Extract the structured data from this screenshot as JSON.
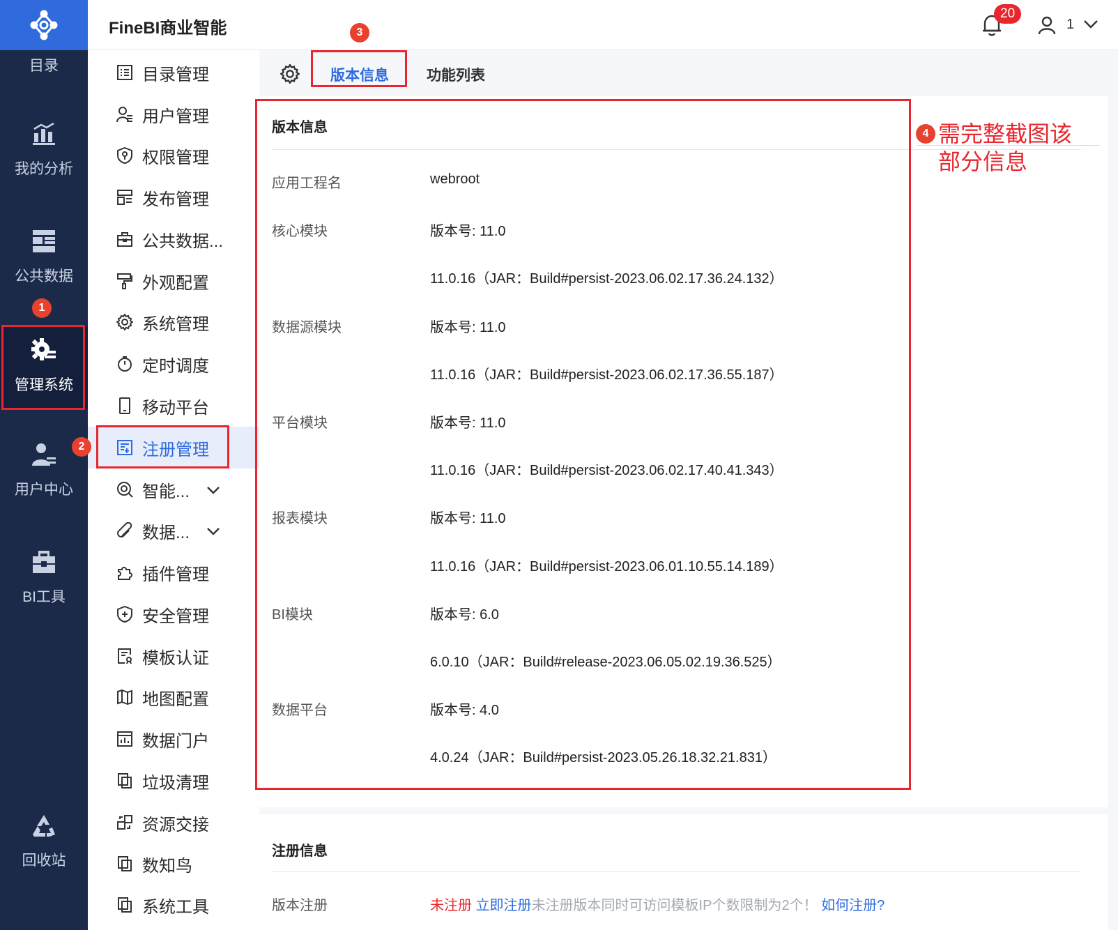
{
  "app_title": "FineBI商业智能",
  "notifications": {
    "count": "20"
  },
  "user": {
    "name": "1"
  },
  "rail": {
    "items": [
      {
        "label": "目录",
        "icon": "catalog-icon"
      },
      {
        "label": "我的分析",
        "icon": "analysis-chart-icon"
      },
      {
        "label": "公共数据",
        "icon": "public-data-icon"
      },
      {
        "label": "管理系统",
        "icon": "admin-gear-icon",
        "active": true
      },
      {
        "label": "用户中心",
        "icon": "user-center-icon"
      },
      {
        "label": "BI工具",
        "icon": "toolbox-icon"
      },
      {
        "label": "回收站",
        "icon": "recycle-icon"
      }
    ]
  },
  "submenu": {
    "items": [
      {
        "label": "目录管理",
        "icon": "list-icon"
      },
      {
        "label": "用户管理",
        "icon": "user-list-icon"
      },
      {
        "label": "权限管理",
        "icon": "permission-shield-icon"
      },
      {
        "label": "发布管理",
        "icon": "publish-icon"
      },
      {
        "label": "公共数据...",
        "icon": "public-data-briefcase-icon"
      },
      {
        "label": "外观配置",
        "icon": "paint-roller-icon"
      },
      {
        "label": "系统管理",
        "icon": "settings-gear-icon"
      },
      {
        "label": "定时调度",
        "icon": "timer-icon"
      },
      {
        "label": "移动平台",
        "icon": "mobile-icon"
      },
      {
        "label": "注册管理",
        "icon": "register-icon",
        "active": true
      },
      {
        "label": "智能...",
        "icon": "smart-icon",
        "expandable": true
      },
      {
        "label": "数据...",
        "icon": "data-link-icon",
        "expandable": true
      },
      {
        "label": "插件管理",
        "icon": "plugin-icon"
      },
      {
        "label": "安全管理",
        "icon": "security-shield-icon"
      },
      {
        "label": "模板认证",
        "icon": "template-cert-icon"
      },
      {
        "label": "地图配置",
        "icon": "map-icon"
      },
      {
        "label": "数据门户",
        "icon": "data-portal-icon"
      },
      {
        "label": "垃圾清理",
        "icon": "cleanup-icon"
      },
      {
        "label": "资源交接",
        "icon": "resource-handover-icon"
      },
      {
        "label": "数知鸟",
        "icon": "shuzhiniao-icon"
      },
      {
        "label": "系统工具",
        "icon": "system-tools-icon"
      }
    ]
  },
  "tabs": [
    {
      "label": "版本信息",
      "active": true
    },
    {
      "label": "功能列表"
    }
  ],
  "version_info": {
    "title": "版本信息",
    "rows": [
      {
        "label": "应用工程名",
        "value": "webroot"
      },
      {
        "label": "核心模块",
        "value": "版本号: 11.0"
      },
      {
        "label": "",
        "value": "11.0.16（JAR：Build#persist-2023.06.02.17.36.24.132）"
      },
      {
        "label": "数据源模块",
        "value": "版本号: 11.0"
      },
      {
        "label": "",
        "value": "11.0.16（JAR：Build#persist-2023.06.02.17.36.55.187）"
      },
      {
        "label": "平台模块",
        "value": "版本号: 11.0"
      },
      {
        "label": "",
        "value": "11.0.16（JAR：Build#persist-2023.06.02.17.40.41.343）"
      },
      {
        "label": "报表模块",
        "value": "版本号: 11.0"
      },
      {
        "label": "",
        "value": "11.0.16（JAR：Build#persist-2023.06.01.10.55.14.189）"
      },
      {
        "label": "BI模块",
        "value": "版本号: 6.0"
      },
      {
        "label": "",
        "value": "6.0.10（JAR：Build#release-2023.06.05.02.19.36.525）"
      },
      {
        "label": "数据平台",
        "value": "版本号: 4.0"
      },
      {
        "label": "",
        "value": "4.0.24（JAR：Build#persist-2023.05.26.18.32.21.831）"
      }
    ]
  },
  "registration": {
    "title": "注册信息",
    "label": "版本注册",
    "status": "未注册",
    "register_link": "立即注册",
    "notice": "未注册版本同时可访问模板IP个数限制为2个！",
    "howto_link": "如何注册?"
  },
  "annotations": {
    "step1": "1",
    "step2": "2",
    "step3": "3",
    "step4": "4",
    "note": "需完整截图该部分信息"
  },
  "colors": {
    "accent": "#2f6bdc",
    "rail_bg": "#1c2a4a",
    "highlight": "#e8262e"
  }
}
